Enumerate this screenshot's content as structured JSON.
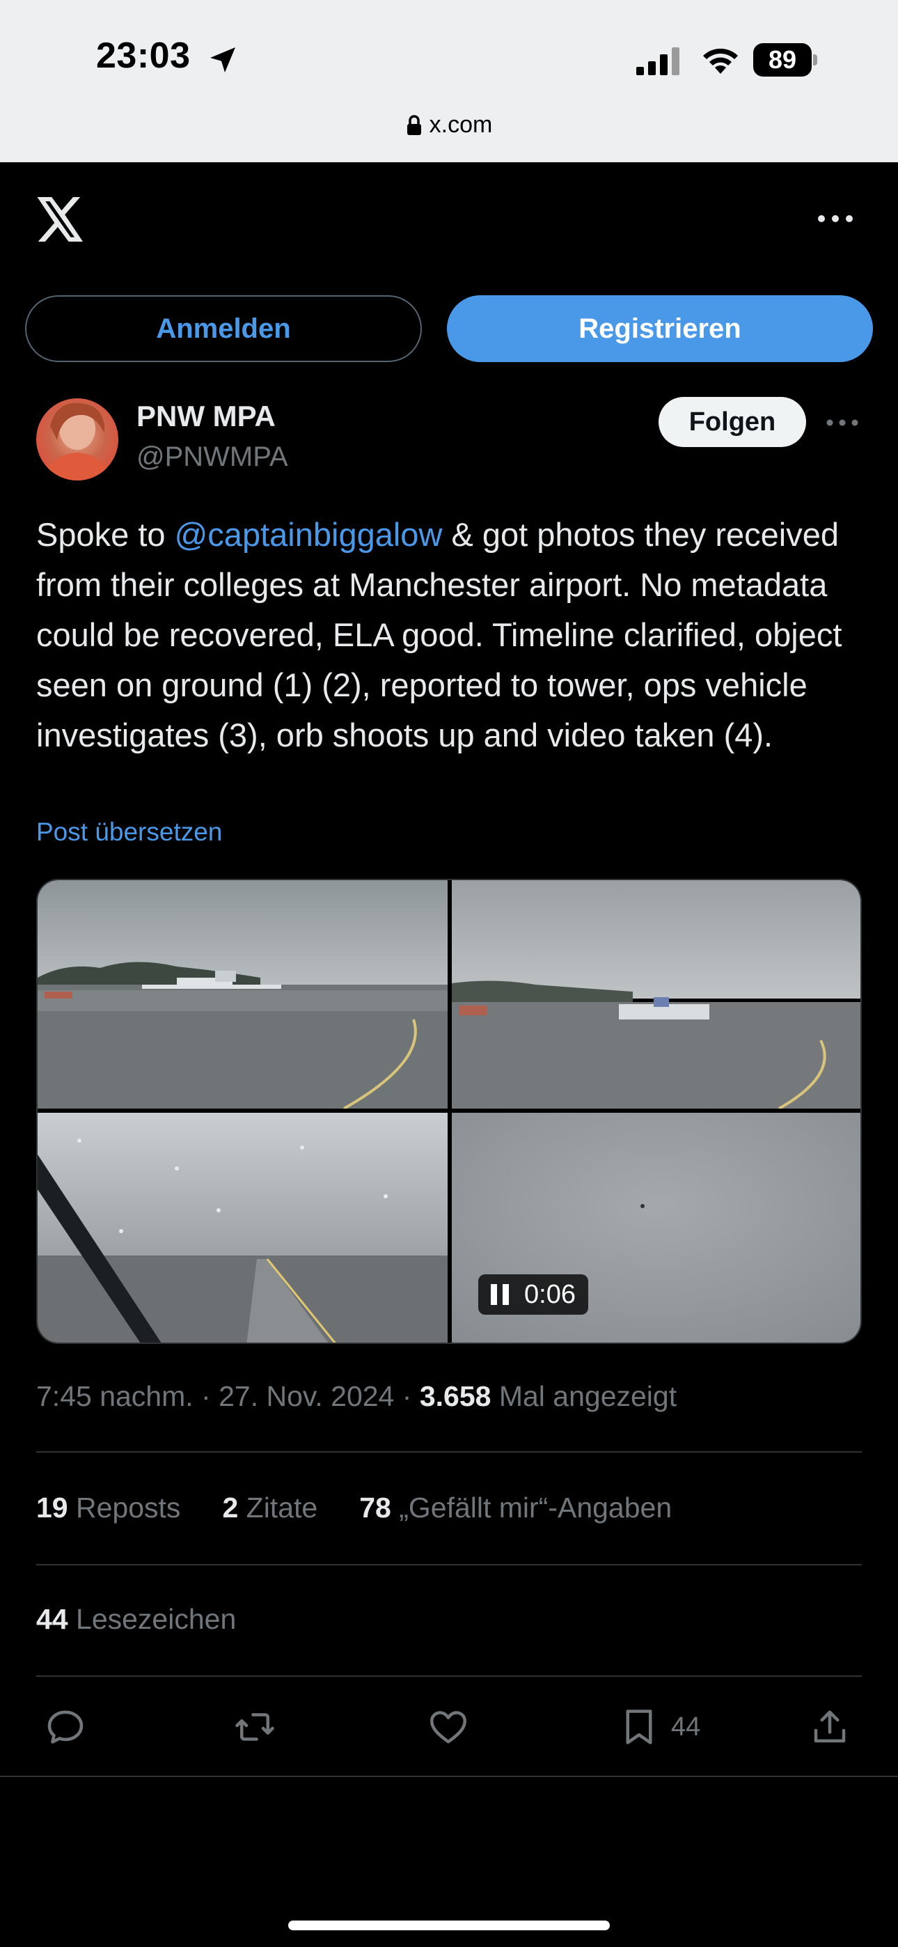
{
  "status_bar": {
    "time": "23:03",
    "battery": "89",
    "url": "x.com"
  },
  "auth": {
    "login_label": "Anmelden",
    "register_label": "Registrieren"
  },
  "author": {
    "name": "PNW MPA",
    "handle": "@PNWMPA",
    "follow_label": "Folgen"
  },
  "tweet": {
    "text_before": "Spoke to ",
    "mention": "@captainbiggalow",
    "text_after": " & got photos they received from their colleges at Manchester airport. No metadata could be recovered, ELA good. Timeline clarified, object seen on ground (1) (2), reported to tower, ops vehicle investigates (3), orb shoots up and video taken (4).",
    "translate_label": "Post übersetzen",
    "video_time": "0:06"
  },
  "meta": {
    "time": "7:45 nachm.",
    "date": "27. Nov. 2024",
    "views_count": "3.658",
    "views_label": "Mal angezeigt",
    "separator": "·"
  },
  "stats": {
    "reposts_count": "19",
    "reposts_label": "Reposts",
    "quotes_count": "2",
    "quotes_label": "Zitate",
    "likes_count": "78",
    "likes_label": "„Gefällt mir“-Angaben",
    "bookmarks_count": "44",
    "bookmarks_label": "Lesezeichen"
  },
  "actions": {
    "bookmark_count": "44"
  },
  "icons": [
    "location-arrow-icon",
    "signal-icon",
    "wifi-icon",
    "lock-icon",
    "x-logo-icon",
    "more-icon",
    "pause-icon",
    "reply-icon",
    "repost-icon",
    "like-icon",
    "bookmark-icon",
    "share-icon"
  ],
  "colors": {
    "accent": "#4a99e9",
    "background": "#000000",
    "text_primary": "#e7e9ea",
    "text_secondary": "#71767b",
    "divider": "#2f3336"
  }
}
